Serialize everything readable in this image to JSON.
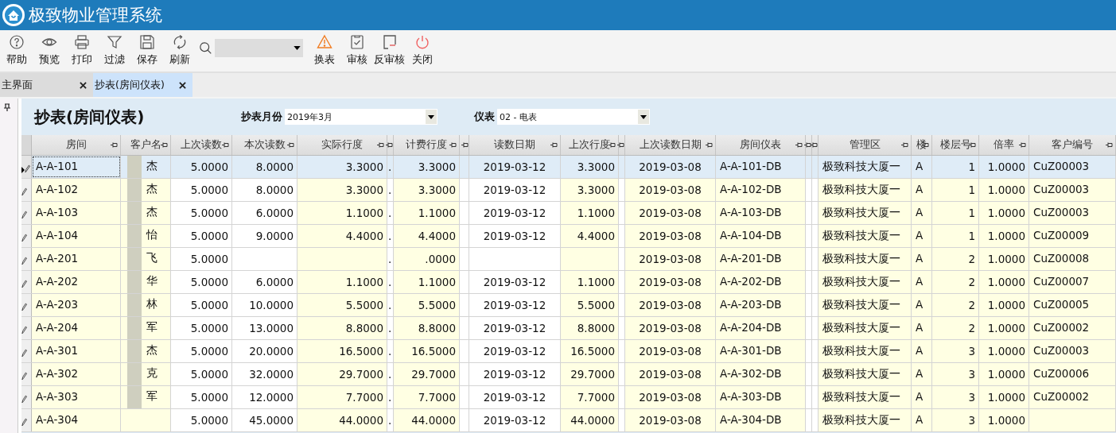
{
  "app": {
    "title": "极致物业管理系统"
  },
  "toolbar_left": [
    {
      "label": "帮助",
      "kind": "help"
    },
    {
      "label": "预览",
      "kind": "preview"
    },
    {
      "label": "打印",
      "kind": "print"
    },
    {
      "label": "过滤",
      "kind": "filter"
    },
    {
      "label": "保存",
      "kind": "save"
    },
    {
      "label": "刷新",
      "kind": "refresh"
    }
  ],
  "toolbar_right": [
    {
      "label": "换表",
      "kind": "warning"
    },
    {
      "label": "审核",
      "kind": "audit"
    },
    {
      "label": "反审核",
      "kind": "unaudit"
    },
    {
      "label": "关闭",
      "kind": "power"
    }
  ],
  "tabs": [
    {
      "label": "主界面",
      "selected": false
    },
    {
      "label": "抄表(房间仪表)",
      "selected": true
    }
  ],
  "form": {
    "title": "抄表(房间仪表)",
    "month_label": "抄表月份",
    "month_value": "2019年3月",
    "meter_label": "仪表",
    "meter_value": "02 - 电表"
  },
  "table": {
    "columns": [
      {
        "label": "房间",
        "kind": "text"
      },
      {
        "label": "客户名",
        "kind": "name"
      },
      {
        "label": "上次读数",
        "kind": "number"
      },
      {
        "label": "本次读数",
        "kind": "number"
      },
      {
        "label": "实际行度",
        "kind": "number"
      },
      {
        "kind": "narrow"
      },
      {
        "label": "计费行度",
        "kind": "number"
      },
      {
        "kind": "narrow"
      },
      {
        "label": "读数日期",
        "kind": "date"
      },
      {
        "label": "上次行度",
        "kind": "number"
      },
      {
        "kind": "narrow"
      },
      {
        "label": "上次读数日期",
        "kind": "date"
      },
      {
        "label": "房间仪表",
        "kind": "text"
      },
      {
        "kind": "narrow"
      },
      {
        "kind": "narrow"
      },
      {
        "label": "管理区",
        "kind": "text"
      },
      {
        "label": "楼",
        "kind": "text"
      },
      {
        "label": "楼层号",
        "kind": "number"
      },
      {
        "label": "倍率",
        "kind": "number"
      },
      {
        "label": "客户编号",
        "kind": "text"
      }
    ],
    "rows": [
      {
        "selected": true,
        "cells": [
          "A-A-101",
          "杰",
          "5.0000",
          "8.0000",
          "3.3000",
          ".",
          "3.3000",
          null,
          "2019-03-12",
          "3.3000",
          null,
          "2019-03-08",
          "A-A-101-DB",
          null,
          null,
          "极致科技大厦一",
          "A",
          "1",
          "1.0000",
          "CuZ00003"
        ]
      },
      {
        "selected": false,
        "cells": [
          "A-A-102",
          "杰",
          "5.0000",
          "8.0000",
          "3.3000",
          ".",
          "3.3000",
          null,
          "2019-03-12",
          "3.3000",
          null,
          "2019-03-08",
          "A-A-102-DB",
          null,
          null,
          "极致科技大厦一",
          "A",
          "1",
          "1.0000",
          "CuZ00003"
        ]
      },
      {
        "selected": false,
        "cells": [
          "A-A-103",
          "杰",
          "5.0000",
          "6.0000",
          "1.1000",
          ".",
          "1.1000",
          null,
          "2019-03-12",
          "1.1000",
          null,
          "2019-03-08",
          "A-A-103-DB",
          null,
          null,
          "极致科技大厦一",
          "A",
          "1",
          "1.0000",
          "CuZ00003"
        ]
      },
      {
        "selected": false,
        "cells": [
          "A-A-104",
          "怡",
          "5.0000",
          "9.0000",
          "4.4000",
          ".",
          "4.4000",
          null,
          "2019-03-12",
          "4.4000",
          null,
          "2019-03-08",
          "A-A-104-DB",
          null,
          null,
          "极致科技大厦一",
          "A",
          "1",
          "1.0000",
          "CuZ00009"
        ]
      },
      {
        "selected": false,
        "cells": [
          "A-A-201",
          "飞",
          "5.0000",
          null,
          null,
          ".",
          ".0000",
          null,
          null,
          null,
          null,
          "2019-03-08",
          "A-A-201-DB",
          null,
          null,
          "极致科技大厦一",
          "A",
          "2",
          "1.0000",
          "CuZ00008"
        ]
      },
      {
        "selected": false,
        "cells": [
          "A-A-202",
          "华",
          "5.0000",
          "6.0000",
          "1.1000",
          ".",
          "1.1000",
          null,
          "2019-03-12",
          "1.1000",
          null,
          "2019-03-08",
          "A-A-202-DB",
          null,
          null,
          "极致科技大厦一",
          "A",
          "2",
          "1.0000",
          "CuZ00007"
        ]
      },
      {
        "selected": false,
        "cells": [
          "A-A-203",
          "林",
          "5.0000",
          "10.0000",
          "5.5000",
          ".",
          "5.5000",
          null,
          "2019-03-12",
          "5.5000",
          null,
          "2019-03-08",
          "A-A-203-DB",
          null,
          null,
          "极致科技大厦一",
          "A",
          "2",
          "1.0000",
          "CuZ00005"
        ]
      },
      {
        "selected": false,
        "cells": [
          "A-A-204",
          "军",
          "5.0000",
          "13.0000",
          "8.8000",
          ".",
          "8.8000",
          null,
          "2019-03-12",
          "8.8000",
          null,
          "2019-03-08",
          "A-A-204-DB",
          null,
          null,
          "极致科技大厦一",
          "A",
          "2",
          "1.0000",
          "CuZ00002"
        ]
      },
      {
        "selected": false,
        "cells": [
          "A-A-301",
          "杰",
          "5.0000",
          "20.0000",
          "16.5000",
          ".",
          "16.5000",
          null,
          "2019-03-12",
          "16.5000",
          null,
          "2019-03-08",
          "A-A-301-DB",
          null,
          null,
          "极致科技大厦一",
          "A",
          "3",
          "1.0000",
          "CuZ00003"
        ]
      },
      {
        "selected": false,
        "cells": [
          "A-A-302",
          "克",
          "5.0000",
          "32.0000",
          "29.7000",
          ".",
          "29.7000",
          null,
          "2019-03-12",
          "29.7000",
          null,
          "2019-03-08",
          "A-A-302-DB",
          null,
          null,
          "极致科技大厦一",
          "A",
          "3",
          "1.0000",
          "CuZ00006"
        ]
      },
      {
        "selected": false,
        "cells": [
          "A-A-303",
          "军",
          "5.0000",
          "12.0000",
          "7.7000",
          ".",
          "7.7000",
          null,
          "2019-03-12",
          "7.7000",
          null,
          "2019-03-08",
          "A-A-303-DB",
          null,
          null,
          "极致科技大厦一",
          "A",
          "3",
          "1.0000",
          "CuZ00002"
        ]
      },
      {
        "selected": false,
        "cells": [
          "A-A-304",
          null,
          "5.0000",
          "45.0000",
          "44.0000",
          ".",
          "44.0000",
          null,
          "2019-03-12",
          "44.0000",
          null,
          "2019-03-08",
          "A-A-304-DB",
          null,
          null,
          "极致科技大厦一",
          "A",
          "3",
          "1.0000",
          null
        ]
      }
    ]
  }
}
